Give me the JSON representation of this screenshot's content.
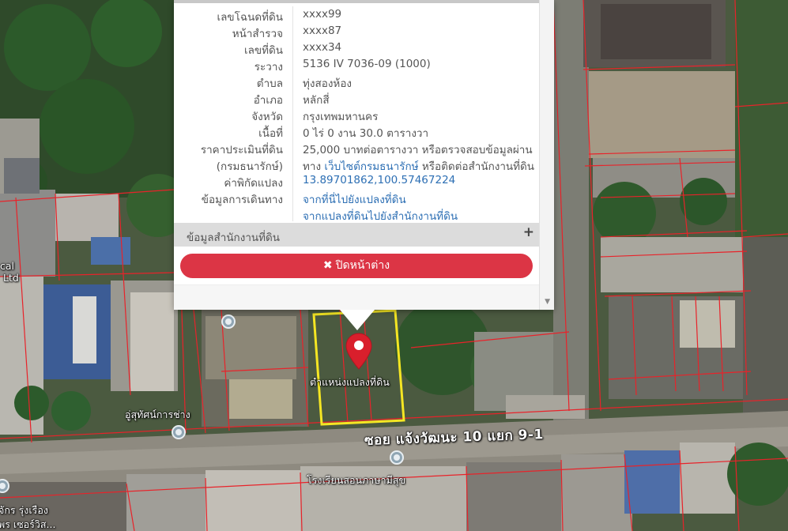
{
  "popup": {
    "rows": [
      {
        "label": "เลขโฉนดที่ดิน",
        "value": "xxxx99",
        "link": false
      },
      {
        "label": "หน้าสำรวจ",
        "value": "xxxx87",
        "link": false
      },
      {
        "label": "เลขที่ดิน",
        "value": "xxxx34",
        "link": false
      },
      {
        "label": "ระวาง",
        "value": "5136 IV 7036-09 (1000)",
        "link": false
      },
      {
        "label": "ตำบล",
        "value": "ทุ่งสองห้อง",
        "link": false
      },
      {
        "label": "อำเภอ",
        "value": "หลักสี่",
        "link": false
      },
      {
        "label": "จังหวัด",
        "value": "กรุงเทพมหานคร",
        "link": false
      },
      {
        "label": "เนื้อที่",
        "value": "0 ไร่ 0 งาน 30.0 ตารางวา",
        "link": false
      },
      {
        "label": "ราคาประเมินที่ดิน",
        "value": "25,000 บาทต่อตารางวา หรือตรวจสอบข้อมูลผ่าน",
        "link": false
      },
      {
        "label": "(กรมธนารักษ์)",
        "value_prefix": "ทาง ",
        "value_link": "เว็บไซต์กรมธนารักษ์",
        "value_suffix": " หรือติดต่อสำนักงานที่ดิน"
      },
      {
        "label": "ค่าพิกัดแปลง",
        "value": "13.89701862,100.57467224",
        "link": true
      },
      {
        "label": "ข้อมูลการเดินทาง",
        "value": "จากที่นี่ไปยังแปลงที่ดิน",
        "link": true
      },
      {
        "label": "",
        "value": "จากแปลงที่ดินไปยังสำนักงานที่ดิน",
        "link": true
      }
    ],
    "office_section": "ข้อมูลสำนักงานที่ดิน",
    "office_expand": "+",
    "close_label": "ปิดหน้าต่าง",
    "close_icon": "✖",
    "scroll_arrow": "▼"
  },
  "map": {
    "road_label": "ซอย แจ้งวัฒนะ 10 แยก 9-1",
    "marker_label": "ตำแหน่งแปลงที่ดิน",
    "pois": [
      {
        "name": "อู่สุทัศน์การช่าง"
      },
      {
        "name": "โรงเรียนสอนภาษามีสุข"
      },
      {
        "name": "จักร รุ่งเรือง"
      },
      {
        "name": "พร เซอร์วิส..."
      },
      {
        "name": "cal"
      },
      {
        "name": "Ltd"
      }
    ],
    "colors": {
      "parcel_lines": "#e8232a",
      "selected_parcel": "#f5e623",
      "marker": "#d91f2c",
      "close_button": "#dc3545",
      "link": "#2d6fb4"
    }
  }
}
